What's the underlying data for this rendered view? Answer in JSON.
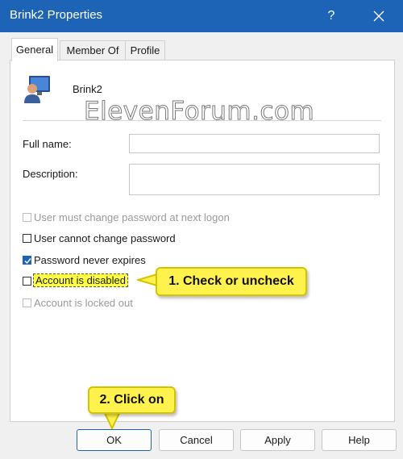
{
  "window": {
    "title": "Brink2 Properties",
    "help_glyph": "?",
    "accent_color": "#1d63b6"
  },
  "tabs": [
    {
      "label": "General",
      "active": true
    },
    {
      "label": "Member Of",
      "active": false
    },
    {
      "label": "Profile",
      "active": false
    }
  ],
  "user": {
    "name": "Brink2",
    "icon": "user-account-icon"
  },
  "watermark": "ElevenForum.com",
  "fields": {
    "full_name_label": "Full name:",
    "full_name_value": "",
    "description_label": "Description:",
    "description_value": ""
  },
  "checkboxes": [
    {
      "label": "User must change password at next logon",
      "checked": false,
      "enabled": false
    },
    {
      "label": "User cannot change password",
      "checked": false,
      "enabled": true
    },
    {
      "label": "Password never expires",
      "checked": true,
      "enabled": true
    },
    {
      "label": "Account is disabled",
      "checked": false,
      "enabled": true,
      "highlighted": true
    },
    {
      "label": "Account is locked out",
      "checked": false,
      "enabled": false
    }
  ],
  "callouts": {
    "step1": "1. Check or uncheck",
    "step2": "2. Click on"
  },
  "buttons": {
    "ok": "OK",
    "cancel": "Cancel",
    "apply": "Apply",
    "help": "Help"
  }
}
